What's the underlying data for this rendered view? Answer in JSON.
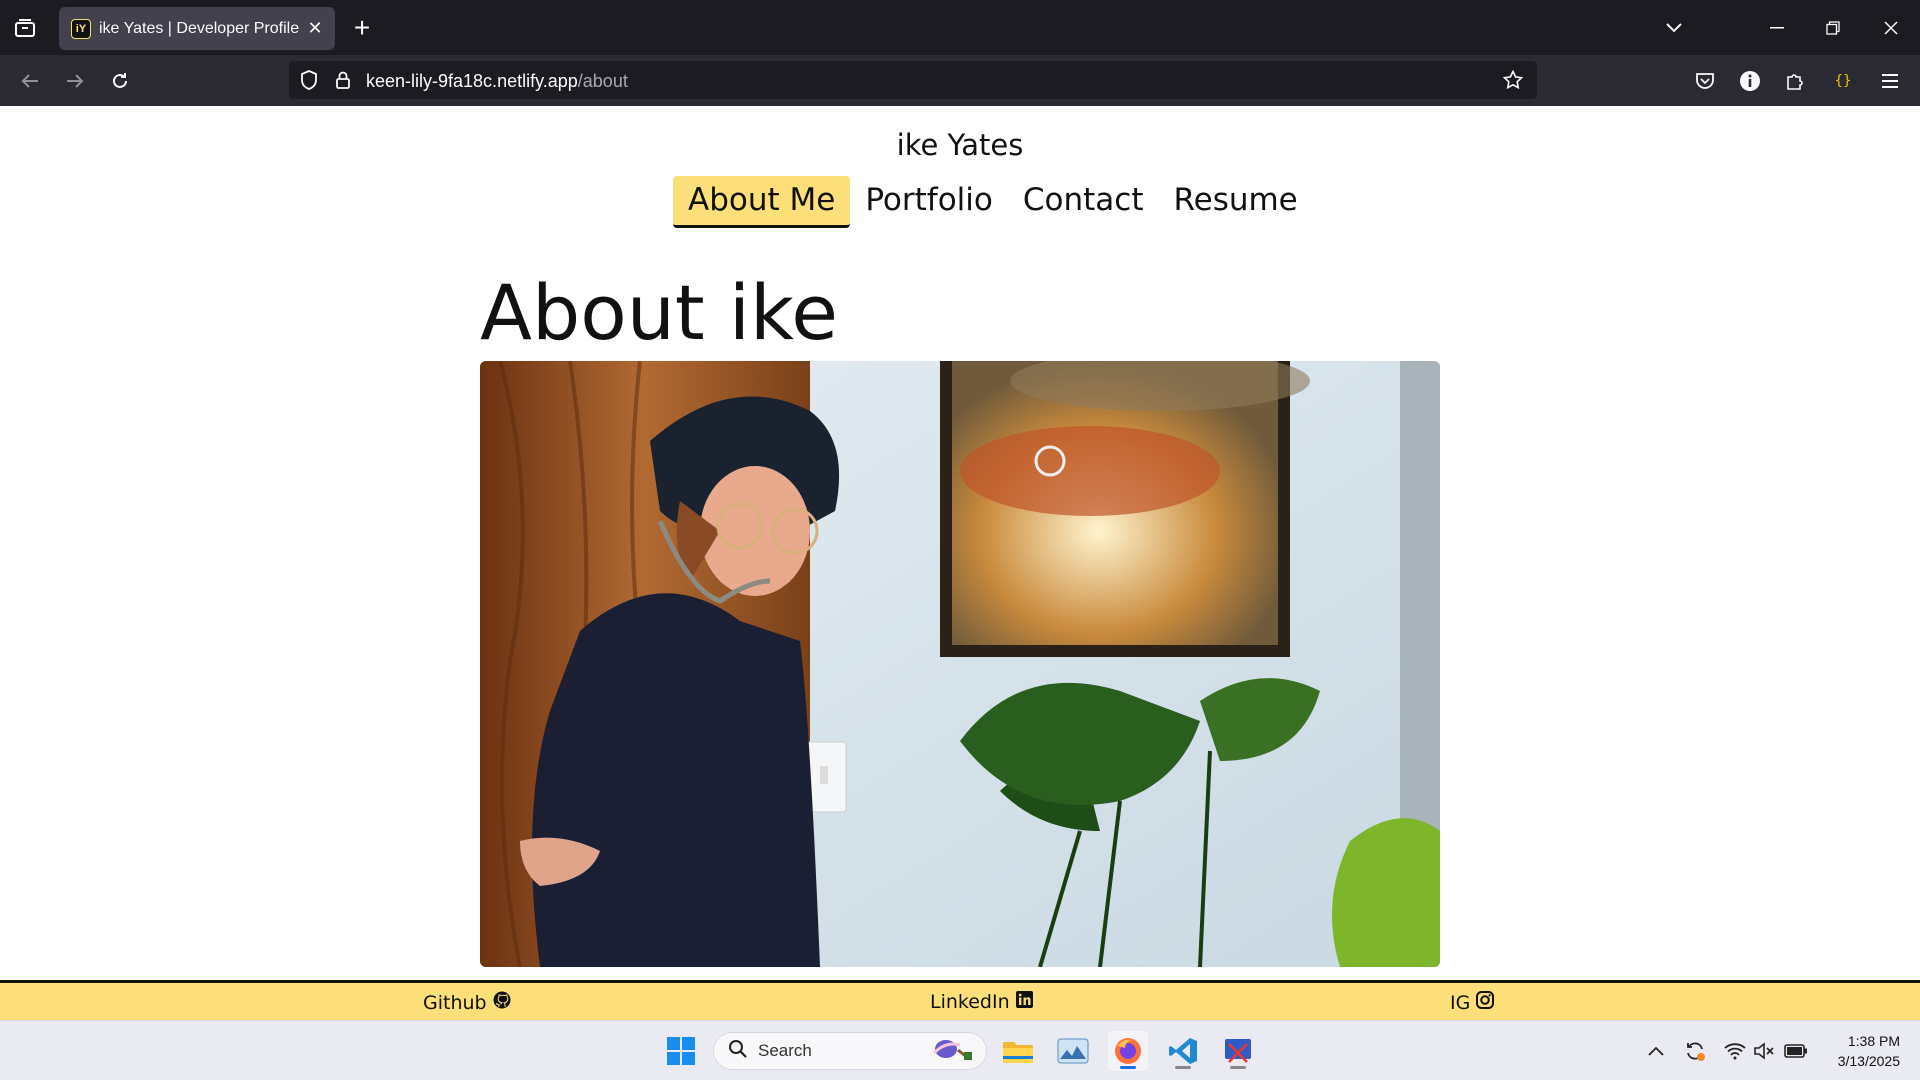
{
  "browser": {
    "tab_title": "ike Yates | Developer Profile",
    "tab_favicon_text": "iY",
    "url_host": "keen-lily-9fa18c.netlify.app",
    "url_path": "/about"
  },
  "site": {
    "name": "ike Yates",
    "nav": [
      {
        "label": "About Me",
        "active": true
      },
      {
        "label": "Portfolio",
        "active": false
      },
      {
        "label": "Contact",
        "active": false
      },
      {
        "label": "Resume",
        "active": false
      }
    ],
    "heading": "About ike",
    "accent_color": "#fddf7a"
  },
  "footer": {
    "github": "Github",
    "linkedin": "LinkedIn",
    "ig": "IG"
  },
  "taskbar": {
    "search_label": "Search",
    "time": "1:38 PM",
    "date": "3/13/2025"
  }
}
